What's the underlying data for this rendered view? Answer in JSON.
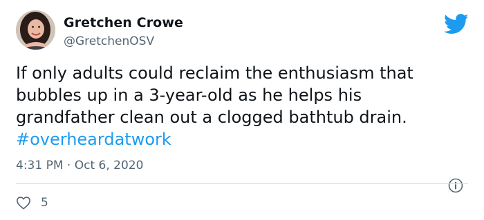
{
  "author": {
    "name": "Gretchen Crowe",
    "handle": "@GretchenOSV"
  },
  "tweet": {
    "text": "If only adults could reclaim the enthusiasm that bubbles up in a 3-year-old as he helps his grandfather clean out a clogged bathtub drain.",
    "hashtag": "#overheardatwork",
    "time": "4:31 PM",
    "separator": "·",
    "date": "Oct 6, 2020",
    "likes": "5"
  },
  "colors": {
    "link": "#1d9bf0",
    "muted": "#536471",
    "divider": "#cfd9de"
  },
  "icons": {
    "brand": "twitter-bird-icon",
    "info": "info-icon",
    "like": "heart-icon"
  }
}
